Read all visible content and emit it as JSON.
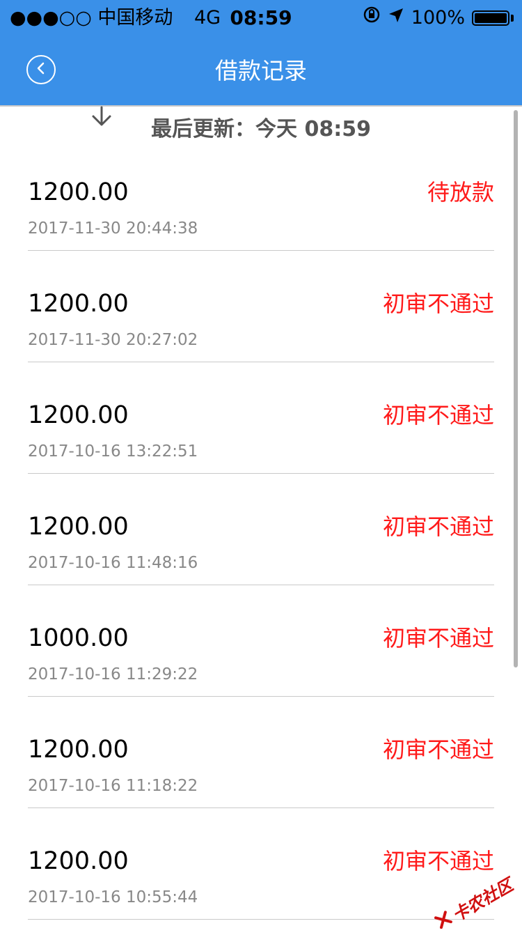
{
  "status_bar": {
    "carrier": "●●●○○ 中国移动",
    "network": "4G",
    "time": "08:59",
    "battery": "100%",
    "icons": [
      "orientation-lock-icon",
      "location-arrow-icon",
      "battery-icon"
    ]
  },
  "nav": {
    "title": "借款记录",
    "back_icon": "chevron-left-circle-icon",
    "color": "#3a90e8"
  },
  "refresh": {
    "text": "最后更新：今天 08:59",
    "icon": "arrow-down-icon"
  },
  "records": [
    {
      "amount": "1200.00",
      "time": "2017-11-30 20:44:38",
      "status": "待放款"
    },
    {
      "amount": "1200.00",
      "time": "2017-11-30 20:27:02",
      "status": "初审不通过"
    },
    {
      "amount": "1200.00",
      "time": "2017-10-16 13:22:51",
      "status": "初审不通过"
    },
    {
      "amount": "1200.00",
      "time": "2017-10-16 11:48:16",
      "status": "初审不通过"
    },
    {
      "amount": "1000.00",
      "time": "2017-10-16 11:29:22",
      "status": "初审不通过"
    },
    {
      "amount": "1200.00",
      "time": "2017-10-16 11:18:22",
      "status": "初审不通过"
    },
    {
      "amount": "1200.00",
      "time": "2017-10-16 10:55:44",
      "status": "初审不通过"
    }
  ],
  "status_color": "#ff1a1a",
  "watermark": "卡农社区"
}
